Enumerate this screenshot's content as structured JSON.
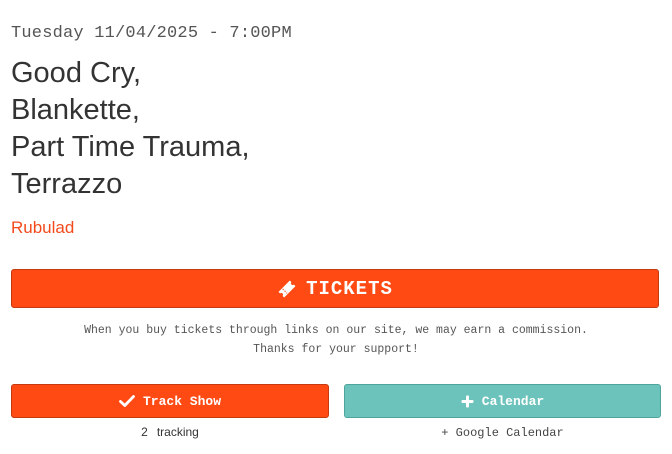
{
  "event": {
    "datetime": "Tuesday 11/04/2025 - 7:00PM",
    "lineup": [
      "Good Cry,",
      "Blankette,",
      "Part Time Trauma,",
      "Terrazzo"
    ],
    "venue": "Rubulad"
  },
  "tickets": {
    "label": "TICKETS",
    "icon": "ticket-icon"
  },
  "disclaimer": {
    "line1": "When you buy tickets through links on our site, we may earn a commission.",
    "line2": "Thanks for your support!"
  },
  "track": {
    "label": "Track Show",
    "icon": "checkmark-icon",
    "count": "2",
    "count_label": "tracking"
  },
  "calendar": {
    "label": "Calendar",
    "icon": "plus-icon",
    "google_link": "+ Google Calendar"
  },
  "colors": {
    "accent": "#ff4a14",
    "venue": "#f24a1d",
    "calendar": "#6cc3bb"
  }
}
